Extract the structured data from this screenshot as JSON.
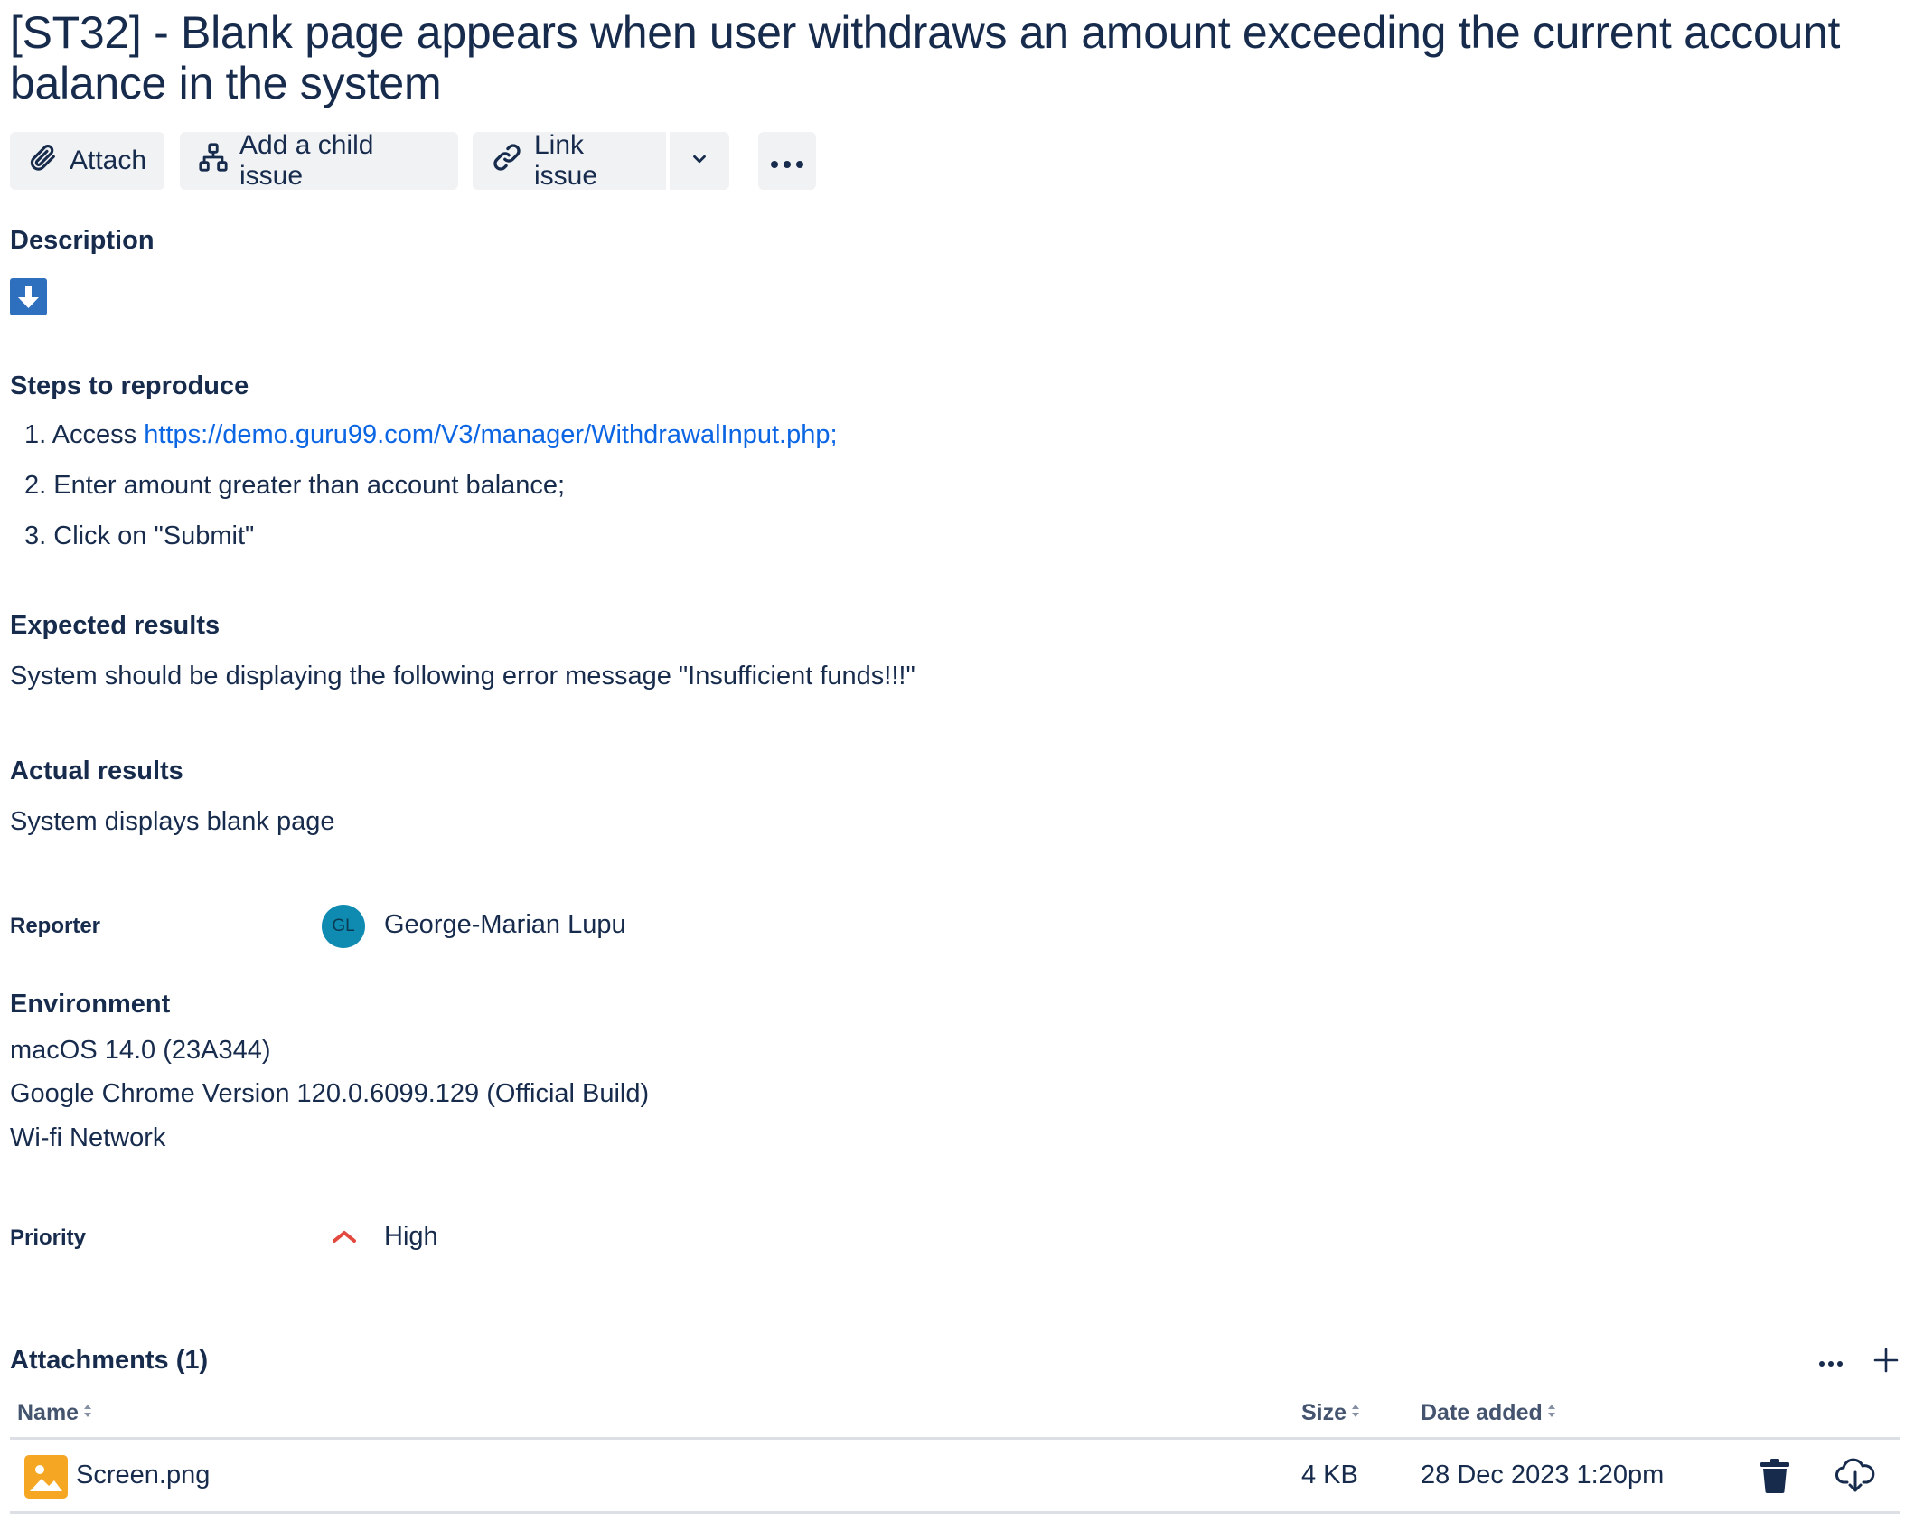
{
  "issue": {
    "title": "[ST32] - Blank page appears when user withdraws an amount exceeding the current account balance in the system"
  },
  "toolbar": {
    "attach_label": "Attach",
    "add_child_label": "Add a child issue",
    "link_issue_label": "Link issue"
  },
  "description": {
    "heading": "Description",
    "steps_heading": "Steps to reproduce",
    "steps": [
      {
        "number": "1.",
        "prefix": "Access",
        "link": "https://demo.guru99.com/V3/manager/WithdrawalInput.php;"
      },
      {
        "number": "2.",
        "text": "Enter amount greater than account balance;"
      },
      {
        "number": "3.",
        "text": "Click on \"Submit\""
      }
    ],
    "expected_heading": "Expected results",
    "expected_text": "System should be displaying the following error message \"Insufficient funds!!!\"",
    "actual_heading": "Actual results",
    "actual_text": "System displays blank page"
  },
  "reporter": {
    "label": "Reporter",
    "initials": "GL",
    "name": "George-Marian Lupu",
    "avatar_color": "#0f8ab0"
  },
  "environment": {
    "heading": "Environment",
    "lines": [
      "macOS 14.0 (23A344)",
      "Google Chrome Version 120.0.6099.129 (Official Build)",
      "Wi-fi Network"
    ]
  },
  "priority": {
    "label": "Priority",
    "value": "High",
    "icon": "priority-high-icon",
    "color": "#e2483d"
  },
  "attachments": {
    "heading": "Attachments (1)",
    "columns": {
      "name": "Name",
      "size": "Size",
      "date": "Date added"
    },
    "rows": [
      {
        "name": "Screen.png",
        "size": "4 KB",
        "date": "28 Dec 2023 1:20pm",
        "icon": "image-file-icon"
      }
    ]
  },
  "colors": {
    "text": "#172b4d",
    "link": "#0c66e4",
    "button_bg": "#f1f2f4",
    "image_icon": "#f5a623",
    "download_icon": "#2a6fb8"
  }
}
